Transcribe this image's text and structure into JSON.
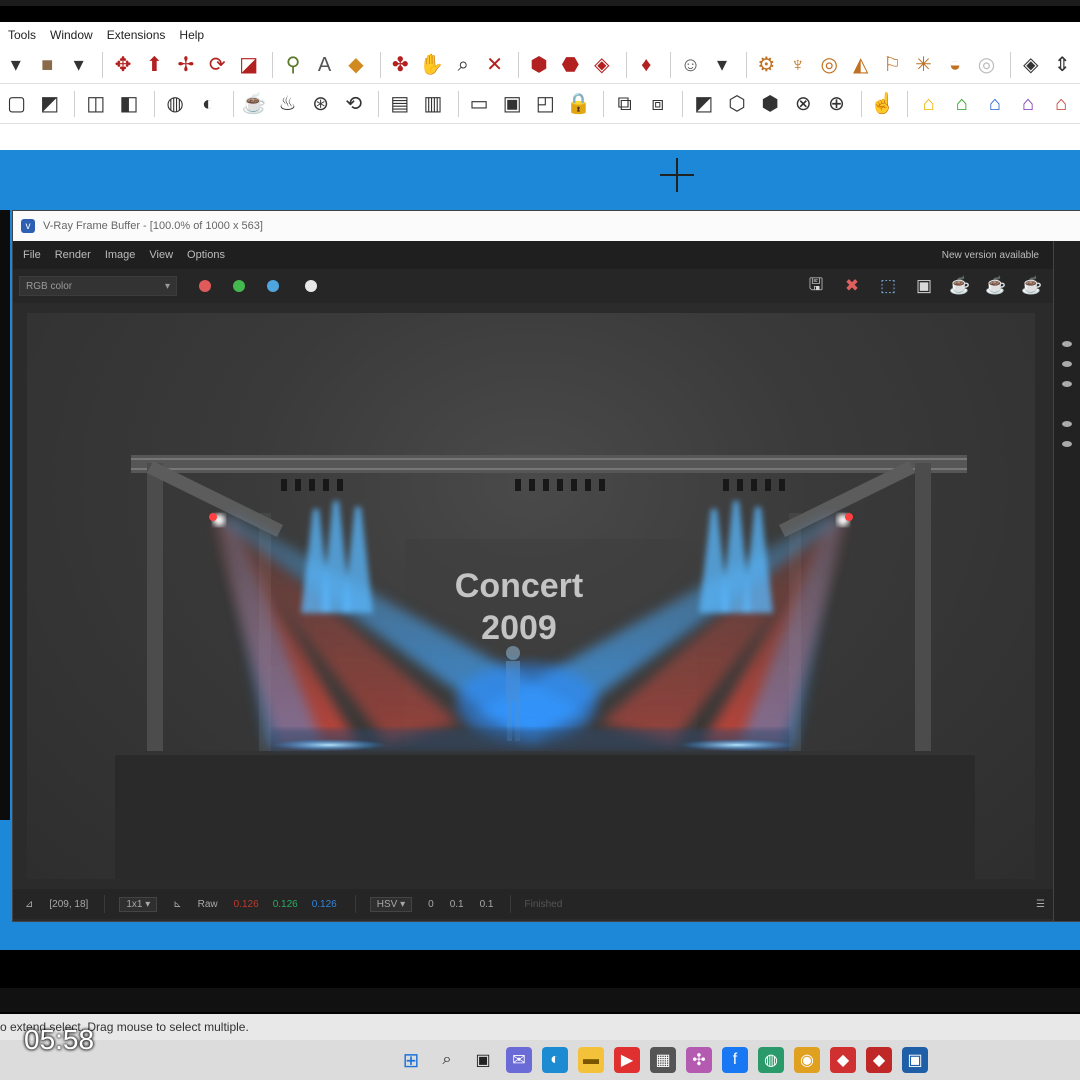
{
  "sketchup": {
    "menu": [
      "Tools",
      "Window",
      "Extensions",
      "Help"
    ],
    "status_text": "o extend select. Drag mouse to select multiple."
  },
  "vfb": {
    "title": "V-Ray Frame Buffer - [100.0% of 1000 x 563]",
    "menu": [
      "File",
      "Render",
      "Image",
      "View",
      "Options"
    ],
    "new_version": "New version available",
    "channel": "RGB color",
    "channel_dots": [
      "#e05a5a",
      "#43b94f",
      "#4fa6df",
      "#e8e8e8"
    ],
    "render_text": {
      "line1": "Concert",
      "line2": "2009"
    },
    "status": {
      "coords": "[209, 18]",
      "zoom": "1x1",
      "mode": "Raw",
      "r": "0.126",
      "g": "0.126",
      "b": "0.126",
      "space": "HSV",
      "h": "0",
      "s": "0.1",
      "v": "0.1",
      "state": "Finished"
    }
  },
  "clock": "05:58"
}
